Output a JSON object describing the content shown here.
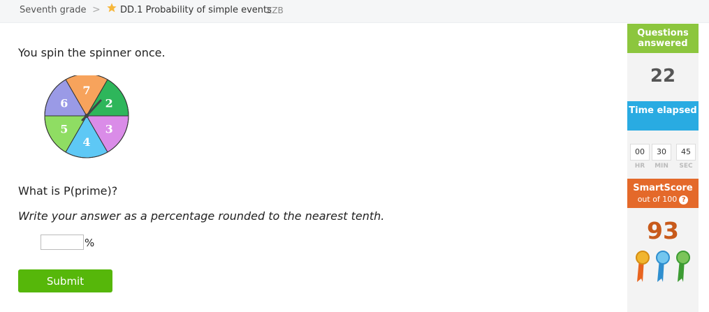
{
  "breadcrumb": {
    "grade": "Seventh grade",
    "separator": ">",
    "skill": "DD.1 Probability of simple events",
    "code": "ZZB"
  },
  "question": {
    "text": "You spin the spinner once.",
    "ask": "What is P(prime)?",
    "instruction": "Write your answer as a percentage rounded to the nearest tenth.",
    "answer_value": "",
    "unit": "%",
    "submit_label": "Submit"
  },
  "spinner": {
    "sections": [
      {
        "label": "7",
        "color": "#f7a35c"
      },
      {
        "label": "2",
        "color": "#2eb65b"
      },
      {
        "label": "3",
        "color": "#da8ce8"
      },
      {
        "label": "4",
        "color": "#5ec8f5"
      },
      {
        "label": "5",
        "color": "#8fdd63"
      },
      {
        "label": "6",
        "color": "#9a9ae6"
      }
    ]
  },
  "sidebar": {
    "questions_answered_label": "Questions answered",
    "questions_answered_count": "22",
    "time_elapsed_label": "Time elapsed",
    "timer": {
      "hr": "00",
      "min": "30",
      "sec": "45",
      "hr_label": "HR",
      "min_label": "MIN",
      "sec_label": "SEC"
    },
    "smartscore_label": "SmartScore",
    "smartscore_sub": "out of 100",
    "smartscore_help": "?",
    "smartscore_value": "93"
  },
  "colors": {
    "submit_green": "#56b70a",
    "questions_green": "#8cc63e",
    "time_blue": "#29abe2",
    "smartscore_orange": "#e4692a",
    "star_gold": "#f6b73c"
  }
}
